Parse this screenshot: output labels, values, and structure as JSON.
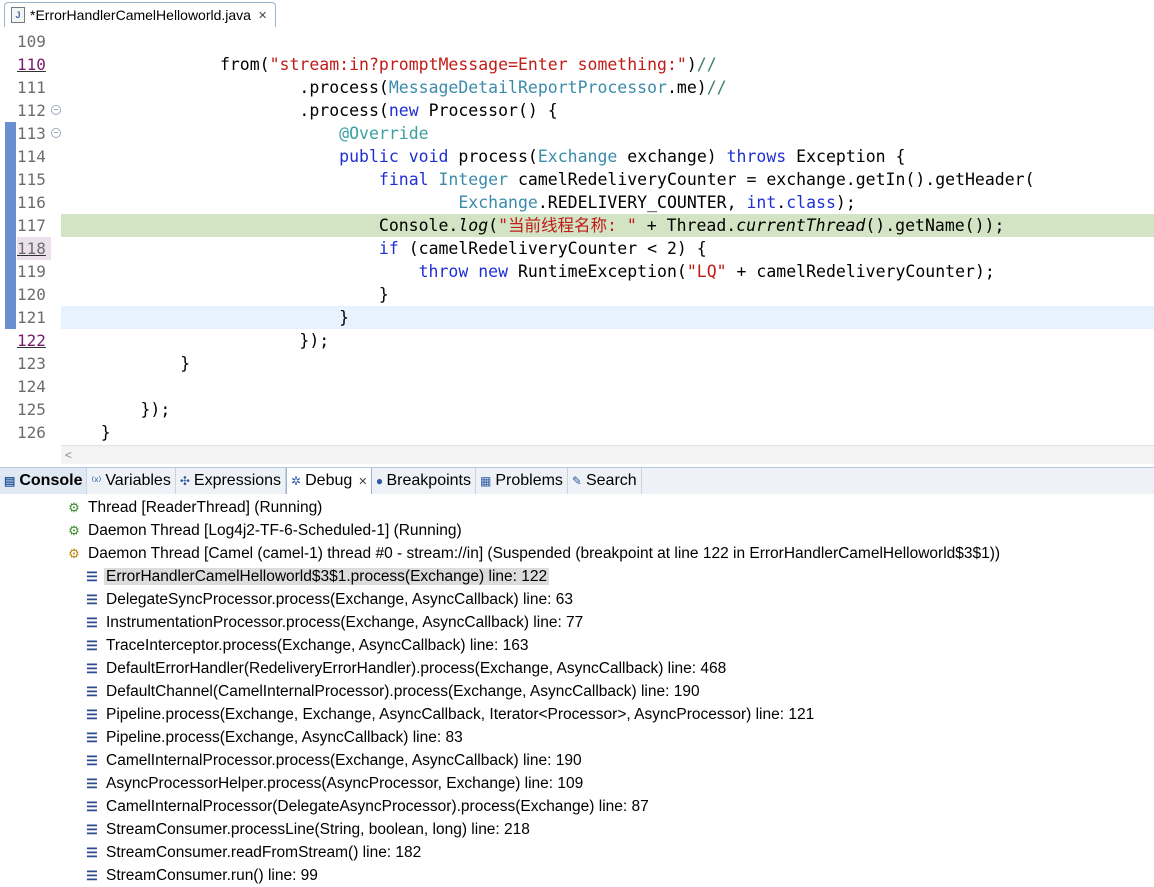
{
  "editor": {
    "tab_label": "*ErrorHandlerCamelHelloworld.java",
    "tab_close": "✕",
    "lines": [
      {
        "num": "109",
        "segs": []
      },
      {
        "num": "110",
        "segs": [
          {
            "t": "                from(",
            "c": ""
          },
          {
            "t": "\"stream:in?promptMessage=Enter something:\"",
            "c": "str2"
          },
          {
            "t": ")",
            "c": ""
          },
          {
            "t": "//",
            "c": "cmt"
          }
        ]
      },
      {
        "num": "111",
        "segs": [
          {
            "t": "                        .process(",
            "c": ""
          },
          {
            "t": "MessageDetailReportProcessor",
            "c": "type"
          },
          {
            "t": ".me)",
            "c": ""
          },
          {
            "t": "//",
            "c": "cmt"
          }
        ]
      },
      {
        "num": "112",
        "segs": [
          {
            "t": "                        .process(",
            "c": ""
          },
          {
            "t": "new",
            "c": "kw"
          },
          {
            "t": " Processor() {",
            "c": ""
          }
        ]
      },
      {
        "num": "113",
        "segs": [
          {
            "t": "                            ",
            "c": ""
          },
          {
            "t": "@Override",
            "c": "ann"
          }
        ]
      },
      {
        "num": "114",
        "segs": [
          {
            "t": "                            ",
            "c": ""
          },
          {
            "t": "public",
            "c": "kw"
          },
          {
            "t": " ",
            "c": ""
          },
          {
            "t": "void",
            "c": "kw"
          },
          {
            "t": " process(",
            "c": ""
          },
          {
            "t": "Exchange",
            "c": "type"
          },
          {
            "t": " exchange) ",
            "c": ""
          },
          {
            "t": "throws",
            "c": "kw"
          },
          {
            "t": " Exception {",
            "c": ""
          }
        ]
      },
      {
        "num": "115",
        "segs": [
          {
            "t": "                                ",
            "c": ""
          },
          {
            "t": "final",
            "c": "kw"
          },
          {
            "t": " ",
            "c": ""
          },
          {
            "t": "Integer",
            "c": "type"
          },
          {
            "t": " camelRedeliveryCounter = exchange.getIn().getHeader(",
            "c": ""
          }
        ]
      },
      {
        "num": "116",
        "segs": [
          {
            "t": "                                        ",
            "c": ""
          },
          {
            "t": "Exchange",
            "c": "type"
          },
          {
            "t": ".REDELIVERY_COUNTER, ",
            "c": ""
          },
          {
            "t": "int",
            "c": "kw"
          },
          {
            "t": ".",
            "c": ""
          },
          {
            "t": "class",
            "c": "kw"
          },
          {
            "t": ");",
            "c": ""
          }
        ]
      },
      {
        "num": "117",
        "segs": [
          {
            "t": "                                Console.",
            "c": ""
          },
          {
            "t": "log",
            "c": "ital"
          },
          {
            "t": "(",
            "c": ""
          },
          {
            "t": "\"当前线程名称: \"",
            "c": "str2"
          },
          {
            "t": " + Thread.",
            "c": ""
          },
          {
            "t": "currentThread",
            "c": "ital"
          },
          {
            "t": "().getName());",
            "c": ""
          }
        ]
      },
      {
        "num": "118",
        "segs": [
          {
            "t": "                                ",
            "c": ""
          },
          {
            "t": "if",
            "c": "kw"
          },
          {
            "t": " (camelRedeliveryCounter < 2) {",
            "c": ""
          }
        ]
      },
      {
        "num": "119",
        "segs": [
          {
            "t": "                                    ",
            "c": ""
          },
          {
            "t": "throw",
            "c": "kw"
          },
          {
            "t": " ",
            "c": ""
          },
          {
            "t": "new",
            "c": "kw"
          },
          {
            "t": " RuntimeException(",
            "c": ""
          },
          {
            "t": "\"LQ\"",
            "c": "str2"
          },
          {
            "t": " + camelRedeliveryCounter);",
            "c": ""
          }
        ]
      },
      {
        "num": "120",
        "segs": [
          {
            "t": "                                }",
            "c": ""
          }
        ]
      },
      {
        "num": "121",
        "segs": [
          {
            "t": "                            }",
            "c": ""
          }
        ]
      },
      {
        "num": "122",
        "segs": [
          {
            "t": "                        });",
            "c": ""
          }
        ]
      },
      {
        "num": "123",
        "segs": [
          {
            "t": "            }",
            "c": ""
          }
        ]
      },
      {
        "num": "124",
        "segs": []
      },
      {
        "num": "125",
        "segs": [
          {
            "t": "        });",
            "c": ""
          }
        ]
      },
      {
        "num": "126",
        "segs": [
          {
            "t": "    }",
            "c": ""
          }
        ]
      }
    ],
    "scroll_left_arrow": "<"
  },
  "views": {
    "tabs": [
      {
        "label": "Console",
        "icon": "console-icon",
        "glyph": "▤"
      },
      {
        "label": "Variables",
        "icon": "variables-icon",
        "glyph": "⁽ˣ⁾"
      },
      {
        "label": "Expressions",
        "icon": "expressions-icon",
        "glyph": "✣"
      },
      {
        "label": "Debug",
        "icon": "debug-icon",
        "glyph": "✲"
      },
      {
        "label": "Breakpoints",
        "icon": "breakpoints-icon",
        "glyph": "⦁"
      },
      {
        "label": "Problems",
        "icon": "problems-icon",
        "glyph": "▦"
      },
      {
        "label": "Search",
        "icon": "search-icon",
        "glyph": "✎"
      }
    ],
    "debug_close": "✕"
  },
  "debug": {
    "threads": [
      {
        "label": "Thread [ReaderThread] (Running)",
        "state": "running"
      },
      {
        "label": "Daemon Thread [Log4j2-TF-6-Scheduled-1] (Running)",
        "state": "running"
      },
      {
        "label": "Daemon Thread [Camel (camel-1) thread #0 - stream://in] (Suspended (breakpoint at line 122 in ErrorHandlerCamelHelloworld$3$1))",
        "state": "suspended"
      }
    ],
    "frames": [
      "ErrorHandlerCamelHelloworld$3$1.process(Exchange) line: 122",
      "DelegateSyncProcessor.process(Exchange, AsyncCallback) line: 63",
      "InstrumentationProcessor.process(Exchange, AsyncCallback) line: 77",
      "TraceInterceptor.process(Exchange, AsyncCallback) line: 163",
      "DefaultErrorHandler(RedeliveryErrorHandler).process(Exchange, AsyncCallback) line: 468",
      "DefaultChannel(CamelInternalProcessor).process(Exchange, AsyncCallback) line: 190",
      "Pipeline.process(Exchange, Exchange, AsyncCallback, Iterator<Processor>, AsyncProcessor) line: 121",
      "Pipeline.process(Exchange, AsyncCallback) line: 83",
      "CamelInternalProcessor.process(Exchange, AsyncCallback) line: 190",
      "AsyncProcessorHelper.process(AsyncProcessor, Exchange) line: 109",
      "CamelInternalProcessor(DelegateAsyncProcessor).process(Exchange) line: 87",
      "StreamConsumer.processLine(String, boolean, long) line: 218",
      "StreamConsumer.readFromStream() line: 182",
      "StreamConsumer.run() line: 99"
    ],
    "selected_frame": 0
  }
}
